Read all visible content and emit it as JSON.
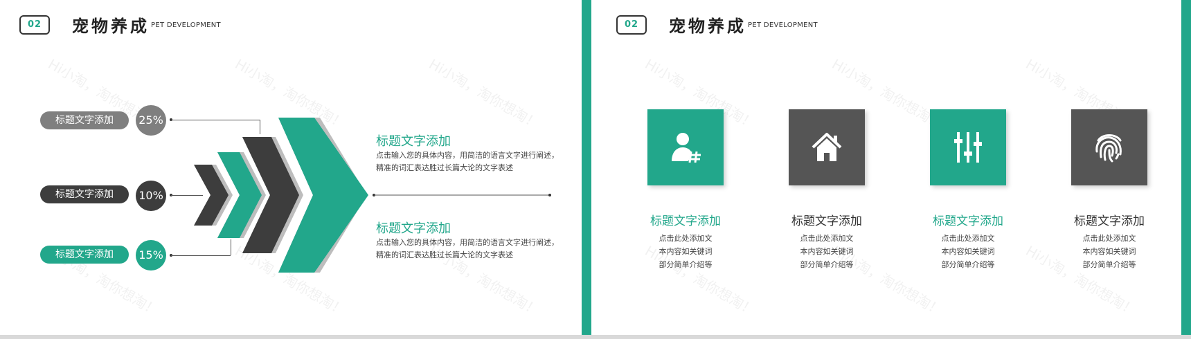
{
  "colors": {
    "accent": "#22a78b",
    "dark": "#3d3d3d",
    "gray": "#7f7f7f",
    "light": "#bdbdbd"
  },
  "left_slide": {
    "number": "02",
    "title": "宠物养成",
    "subtitle": "PET DEVELOPMENT",
    "watermark": "Hi小淘，淘你想淘！",
    "items": [
      {
        "label": "标题文字添加",
        "percent": "25%",
        "color": "#7f7f7f"
      },
      {
        "label": "标题文字添加",
        "percent": "10%",
        "color": "#3d3d3d"
      },
      {
        "label": "标题文字添加",
        "percent": "15%",
        "color": "#22a78b"
      }
    ],
    "texts": [
      {
        "title": "标题文字添加",
        "line1": "点击输入您的具体内容，用简洁的语言文字进行阐述，",
        "line2": "精准的词汇表达胜过长篇大论的文字表述"
      },
      {
        "title": "标题文字添加",
        "line1": "点击输入您的具体内容，用简洁的语言文字进行阐述，",
        "line2": "精准的词汇表达胜过长篇大论的文字表述"
      }
    ]
  },
  "right_slide": {
    "number": "02",
    "title": "宠物养成",
    "subtitle": "PET DEVELOPMENT",
    "cards": [
      {
        "icon": "user-hash-icon",
        "color": "#22a78b",
        "title": "标题文字添加",
        "line1": "点击此处添加文",
        "line2": "本内容如关键词",
        "line3": "部分简单介绍等"
      },
      {
        "icon": "house-icon",
        "color": "#555555",
        "title": "标题文字添加",
        "line1": "点击此处添加文",
        "line2": "本内容如关键词",
        "line3": "部分简单介绍等"
      },
      {
        "icon": "sliders-icon",
        "color": "#22a78b",
        "title": "标题文字添加",
        "line1": "点击此处添加文",
        "line2": "本内容如关键词",
        "line3": "部分简单介绍等"
      },
      {
        "icon": "fingerprint-icon",
        "color": "#555555",
        "title": "标题文字添加",
        "line1": "点击此处添加文",
        "line2": "本内容如关键词",
        "line3": "部分简单介绍等"
      }
    ]
  }
}
